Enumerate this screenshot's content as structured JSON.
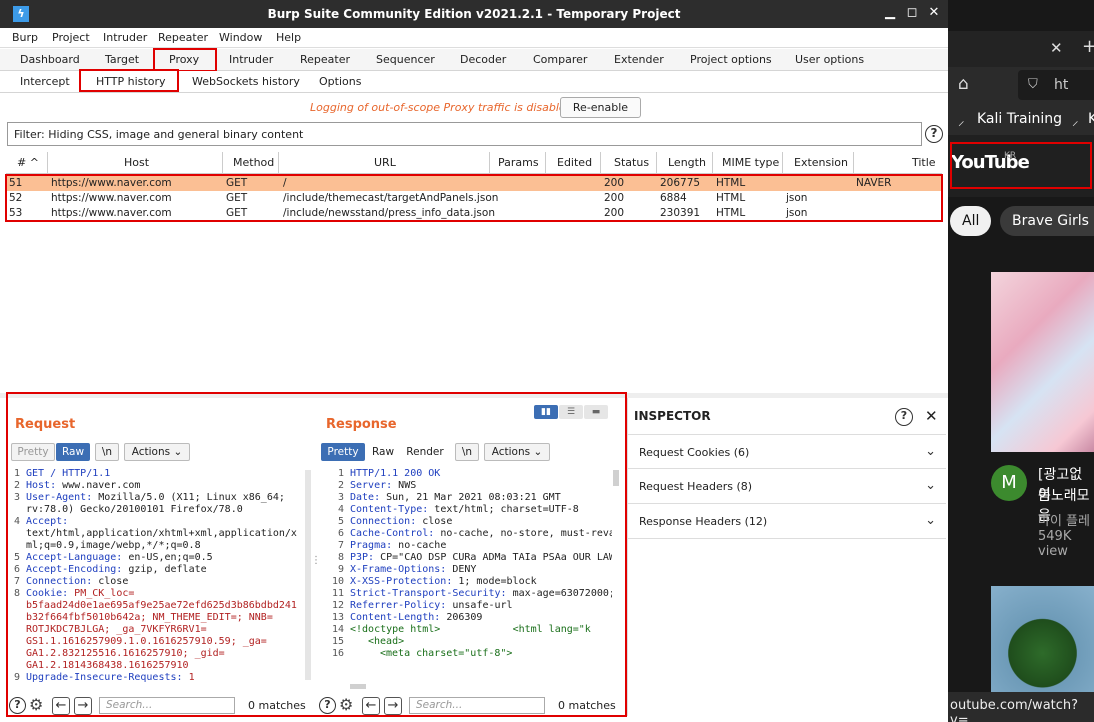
{
  "window": {
    "title": "Burp Suite Community Edition v2021.2.1 - Temporary Project",
    "minimize": "▁",
    "maximize": "◻",
    "close": "✕"
  },
  "menu": [
    "Burp",
    "Project",
    "Intruder",
    "Repeater",
    "Window",
    "Help"
  ],
  "main_tabs": [
    "Dashboard",
    "Target",
    "Proxy",
    "Intruder",
    "Repeater",
    "Sequencer",
    "Decoder",
    "Comparer",
    "Extender",
    "Project options",
    "User options"
  ],
  "proxy_tabs": [
    "Intercept",
    "HTTP history",
    "WebSockets history",
    "Options"
  ],
  "notice": {
    "message": "Logging of out-of-scope Proxy traffic is disabled",
    "button": "Re-enable"
  },
  "filter": {
    "text": "Filter: Hiding CSS, image and general binary content",
    "help": "?"
  },
  "history": {
    "columns": [
      "# ^",
      "Host",
      "Method",
      "URL",
      "Params",
      "Edited",
      "Status",
      "Length",
      "MIME type",
      "Extension",
      "Title"
    ],
    "rows": [
      {
        "num": "51",
        "host": "https://www.naver.com",
        "method": "GET",
        "url": "/",
        "status": "200",
        "length": "206775",
        "mime": "HTML",
        "ext": "",
        "title": "NAVER"
      },
      {
        "num": "52",
        "host": "https://www.naver.com",
        "method": "GET",
        "url": "/include/themecast/targetAndPanels.json",
        "status": "200",
        "length": "6884",
        "mime": "HTML",
        "ext": "json",
        "title": ""
      },
      {
        "num": "53",
        "host": "https://www.naver.com",
        "method": "GET",
        "url": "/include/newsstand/press_info_data.json",
        "status": "200",
        "length": "230391",
        "mime": "HTML",
        "ext": "json",
        "title": ""
      }
    ]
  },
  "request": {
    "title": "Request",
    "buttons": [
      "Pretty",
      "Raw",
      "\\n",
      "Actions"
    ],
    "line_numbers": "1\n2\n3\n\n4\n\n\n5\n6\n7\n8\n\n\n\n\n\n\n9",
    "code": [
      {
        "k": "GET / HTTP/1.1",
        "v": ""
      },
      {
        "k": "Host: ",
        "v": "www.naver.com"
      },
      {
        "k": "User-Agent: ",
        "v": "Mozilla/5.0 (X11; Linux x86_64;"
      },
      {
        "k": "",
        "v": "rv:78.0) Gecko/20100101 Firefox/78.0"
      },
      {
        "k": "Accept:",
        "v": ""
      },
      {
        "k": "",
        "v": "text/html,application/xhtml+xml,application/x"
      },
      {
        "k": "",
        "v": "ml;q=0.9,image/webp,*/*;q=0.8"
      },
      {
        "k": "Accept-Language: ",
        "v": "en-US,en;q=0.5"
      },
      {
        "k": "Accept-Encoding: ",
        "v": "gzip, deflate"
      },
      {
        "k": "Connection: ",
        "v": "close"
      },
      {
        "k": "Cookie: ",
        "v": "PM_CK_loc="
      },
      {
        "k": "",
        "v": "b5faad24d0e1ae695af9e25ae72efd625d3b86bdbd241"
      },
      {
        "k": "",
        "v": "b32f664fbf5010b642a; NM_THEME_EDIT=; NNB="
      },
      {
        "k": "",
        "v": "ROTJKDC7BJLGA; _ga_7VKFYR6RV1="
      },
      {
        "k": "",
        "v": "GS1.1.1616257909.1.0.1616257910.59; _ga="
      },
      {
        "k": "",
        "v": "GA1.2.832125516.1616257910; _gid="
      },
      {
        "k": "",
        "v": "GA1.2.1814368438.1616257910"
      },
      {
        "k": "Upgrade-Insecure-Requests: ",
        "v": "1"
      }
    ],
    "search_placeholder": "Search...",
    "matches": "0 matches"
  },
  "response": {
    "title": "Response",
    "buttons": [
      "Pretty",
      "Raw",
      "Render",
      "\\n",
      "Actions"
    ],
    "line_numbers": "1\n2\n3\n4\n5\n6\n7\n8\n9\n10\n11\n12\n13\n14\n15\n16",
    "code": [
      {
        "k": "HTTP/1.1 200 OK",
        "v": ""
      },
      {
        "k": "Server: ",
        "v": "NWS"
      },
      {
        "k": "Date: ",
        "v": "Sun, 21 Mar 2021 08:03:21 GMT"
      },
      {
        "k": "Content-Type: ",
        "v": "text/html; charset=UTF-8"
      },
      {
        "k": "Connection: ",
        "v": "close"
      },
      {
        "k": "Cache-Control: ",
        "v": "no-cache, no-store, must-reva"
      },
      {
        "k": "Pragma: ",
        "v": "no-cache"
      },
      {
        "k": "P3P: ",
        "v": "CP=\"CAO DSP CURa ADMa TAIa PSAa OUR LAW"
      },
      {
        "k": "X-Frame-Options: ",
        "v": "DENY"
      },
      {
        "k": "X-XSS-Protection: ",
        "v": "1; mode=block"
      },
      {
        "k": "Strict-Transport-Security: ",
        "v": "max-age=63072000;"
      },
      {
        "k": "Referrer-Policy: ",
        "v": "unsafe-url"
      },
      {
        "k": "Content-Length: ",
        "v": "206309"
      },
      {
        "k": "",
        "v": ""
      },
      {
        "k": "",
        "v": ""
      },
      {
        "k": "",
        "v": ""
      }
    ],
    "html_lines": [
      "<!doctype html>",
      "<html lang=\"k",
      "<head>",
      "<meta charset=\"utf-8\">"
    ],
    "search_placeholder": "Search...",
    "matches": "0 matches"
  },
  "inspector": {
    "title": "INSPECTOR",
    "sections": [
      "Request Cookies (6)",
      "Request Headers (8)",
      "Response Headers (12)"
    ]
  },
  "browser": {
    "tab_close": "✕",
    "new_tab": "+",
    "url_fragment": "ht",
    "bookmarks": [
      "Kali Training",
      "K"
    ],
    "youtube_logo": "YouTube",
    "youtube_region": "KR",
    "chips": [
      "All",
      "Brave Girls"
    ],
    "video1": {
      "avatar": "M",
      "title1": "[광고없이",
      "title2": "봄노래모음",
      "channel": "마이 플레",
      "views": "549K view"
    },
    "status_url": "outube.com/watch?v="
  },
  "colors": {
    "accent": "#e8662c",
    "selected_row": "#fbbf94",
    "highlight": "#e00000",
    "pretty_on": "#3c6eb4"
  }
}
